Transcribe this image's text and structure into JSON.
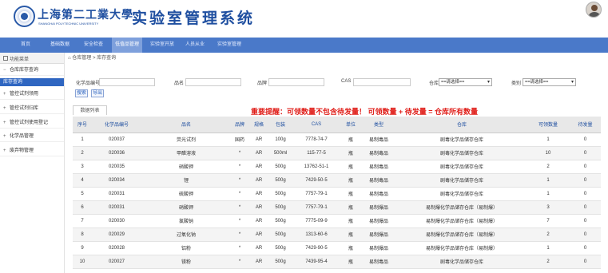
{
  "header": {
    "university_cn": "上海第二工業大學",
    "university_en": "SHANGHAI POLYTECHNIC UNIVERSITY",
    "system_title": "实验室管理系统"
  },
  "nav": [
    {
      "label": "首页"
    },
    {
      "label": "基础数据"
    },
    {
      "label": "安全检查"
    },
    {
      "label": "低值品管理"
    },
    {
      "label": "实验室开放"
    },
    {
      "label": "人员从业"
    },
    {
      "label": "实验室管理"
    }
  ],
  "sidebar": {
    "title": "功能菜单",
    "groups": [
      {
        "label": "仓库库存查询",
        "prefix": "−"
      },
      {
        "label": "管控试剂领用",
        "prefix": "+"
      },
      {
        "label": "管控试剂归库",
        "prefix": "+"
      },
      {
        "label": "管控试剂使用登记",
        "prefix": "+"
      },
      {
        "label": "化学品管理",
        "prefix": "+"
      },
      {
        "label": "废弃物管理",
        "prefix": "+"
      }
    ],
    "active_sub": "库存查询"
  },
  "breadcrumb": "仓库管理 > 库存查询",
  "filters": {
    "label1": "化学品编号",
    "label2": "品名",
    "label3": "品牌",
    "label4": "CAS",
    "label5": "仓库",
    "label6": "类别",
    "select_placeholder": "==请选择==",
    "search_button": "搜索",
    "reset_button": "导出"
  },
  "tab_label": "数据列表",
  "warning": "重要提醒：可领数量不包含待发量！ 可领数量 + 待发量 = 仓库所有数量",
  "table": {
    "headers": [
      "序号",
      "化学品编号",
      "品名",
      "品牌",
      "规格",
      "包装",
      "CAS",
      "单位",
      "类型",
      "仓库",
      "可领数量",
      "待发量"
    ],
    "rows": [
      [
        "1",
        "020037",
        "荧光试剂",
        "国药",
        "AR",
        "100g",
        "7778-74-7",
        "瓶",
        "易制毒品",
        "剧毒化学品储存仓库",
        "1",
        "0"
      ],
      [
        "2",
        "020036",
        "甲醛溶液",
        "*",
        "AR",
        "500ml",
        "115-77-5",
        "瓶",
        "易制毒品",
        "剧毒化学品储存仓库",
        "10",
        "0"
      ],
      [
        "3",
        "020035",
        "硝酸钾",
        "*",
        "AR",
        "500g",
        "13762-51-1",
        "瓶",
        "易制毒品",
        "剧毒化学品储存仓库",
        "2",
        "0"
      ],
      [
        "4",
        "020034",
        "锂",
        "*",
        "AR",
        "500g",
        "7429-50-5",
        "瓶",
        "易制毒品",
        "剧毒化学品储存仓库",
        "1",
        "0"
      ],
      [
        "5",
        "020031",
        "硫酸钾",
        "*",
        "AR",
        "500g",
        "7757-79-1",
        "瓶",
        "易制毒品",
        "剧毒化学品储存仓库",
        "1",
        "0"
      ],
      [
        "6",
        "020031",
        "硝酸钾",
        "*",
        "AR",
        "500g",
        "7757-79-1",
        "瓶",
        "易制爆品",
        "易制爆化学品储存仓库（易制爆）",
        "3",
        "0"
      ],
      [
        "7",
        "020030",
        "氯酸钠",
        "*",
        "AR",
        "500g",
        "7775-09-9",
        "瓶",
        "易制爆品",
        "易制爆化学品储存仓库（易制爆）",
        "7",
        "0"
      ],
      [
        "8",
        "020029",
        "过氧化钠",
        "*",
        "AR",
        "500g",
        "1313-60-6",
        "瓶",
        "易制爆品",
        "易制爆化学品储存仓库（易制爆）",
        "2",
        "0"
      ],
      [
        "9",
        "020028",
        "铝粉",
        "*",
        "AR",
        "500g",
        "7429-90-5",
        "瓶",
        "易制爆品",
        "易制爆化学品储存仓库（易制爆）",
        "1",
        "0"
      ],
      [
        "10",
        "020027",
        "镁粉",
        "*",
        "AR",
        "500g",
        "7439-95-4",
        "瓶",
        "易制毒品",
        "剧毒化学品储存仓库",
        "2",
        "0"
      ]
    ]
  }
}
